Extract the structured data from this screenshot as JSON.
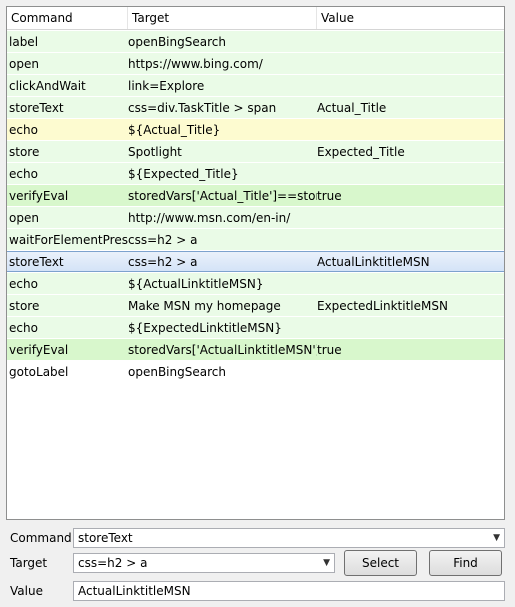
{
  "table": {
    "headers": {
      "command": "Command",
      "target": "Target",
      "value": "Value"
    },
    "rows": [
      {
        "command": "label",
        "target": "openBingSearch",
        "value": "",
        "style": "normal"
      },
      {
        "command": "open",
        "target": "https://www.bing.com/",
        "value": "",
        "style": "normal"
      },
      {
        "command": "clickAndWait",
        "target": "link=Explore",
        "value": "",
        "style": "normal"
      },
      {
        "command": "storeText",
        "target": "css=div.TaskTitle > span",
        "value": "Actual_Title",
        "style": "normal"
      },
      {
        "command": "echo",
        "target": "${Actual_Title}",
        "value": "",
        "style": "yellow"
      },
      {
        "command": "store",
        "target": "Spotlight",
        "value": "Expected_Title",
        "style": "normal"
      },
      {
        "command": "echo",
        "target": "${Expected_Title}",
        "value": "",
        "style": "normal"
      },
      {
        "command": "verifyEval",
        "target": "storedVars['Actual_Title']==store...",
        "value": "true",
        "style": "verify"
      },
      {
        "command": "open",
        "target": "http://www.msn.com/en-in/",
        "value": "",
        "style": "normal"
      },
      {
        "command": "waitForElementPres...",
        "target": "css=h2 > a",
        "value": "",
        "style": "normal"
      },
      {
        "command": "storeText",
        "target": "css=h2 > a",
        "value": "ActualLinktitleMSN",
        "style": "selected"
      },
      {
        "command": "echo",
        "target": "${ActualLinktitleMSN}",
        "value": "",
        "style": "normal"
      },
      {
        "command": "store",
        "target": "Make MSN my homepage",
        "value": "ExpectedLinktitleMSN",
        "style": "normal"
      },
      {
        "command": "echo",
        "target": "${ExpectedLinktitleMSN}",
        "value": "",
        "style": "normal"
      },
      {
        "command": "verifyEval",
        "target": "storedVars['ActualLinktitleMSN']...",
        "value": "true",
        "style": "verify"
      },
      {
        "command": "gotoLabel",
        "target": "openBingSearch",
        "value": "",
        "style": "white"
      }
    ]
  },
  "editor": {
    "command_label": "Command",
    "command_value": "storeText",
    "target_label": "Target",
    "target_value": "css=h2 > a",
    "value_label": "Value",
    "value_value": "ActualLinktitleMSN",
    "select_button": "Select",
    "find_button": "Find"
  },
  "colors": {
    "row_normal": "#eafbe7",
    "row_echo_highlight": "#fdfbd0",
    "row_verify": "#d8f7cc",
    "row_selected": "#d4e3f7"
  },
  "icons": {
    "dropdown": "chevron-down-icon"
  }
}
